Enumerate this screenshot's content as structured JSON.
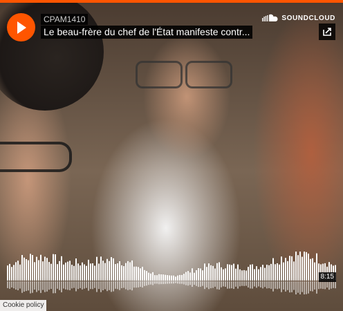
{
  "player": {
    "username": "CPAM1410",
    "track_title": "Le beau-frère du chef de l'État manifeste contr...",
    "brand": "SOUNDCLOUD",
    "duration": "8:15",
    "cookie_policy": "Cookie policy",
    "accent_color": "#ff5500",
    "play_icon": "play-icon",
    "share_icon": "share-icon",
    "logo_icon": "soundcloud-cloud-icon",
    "played_fraction": 0
  }
}
